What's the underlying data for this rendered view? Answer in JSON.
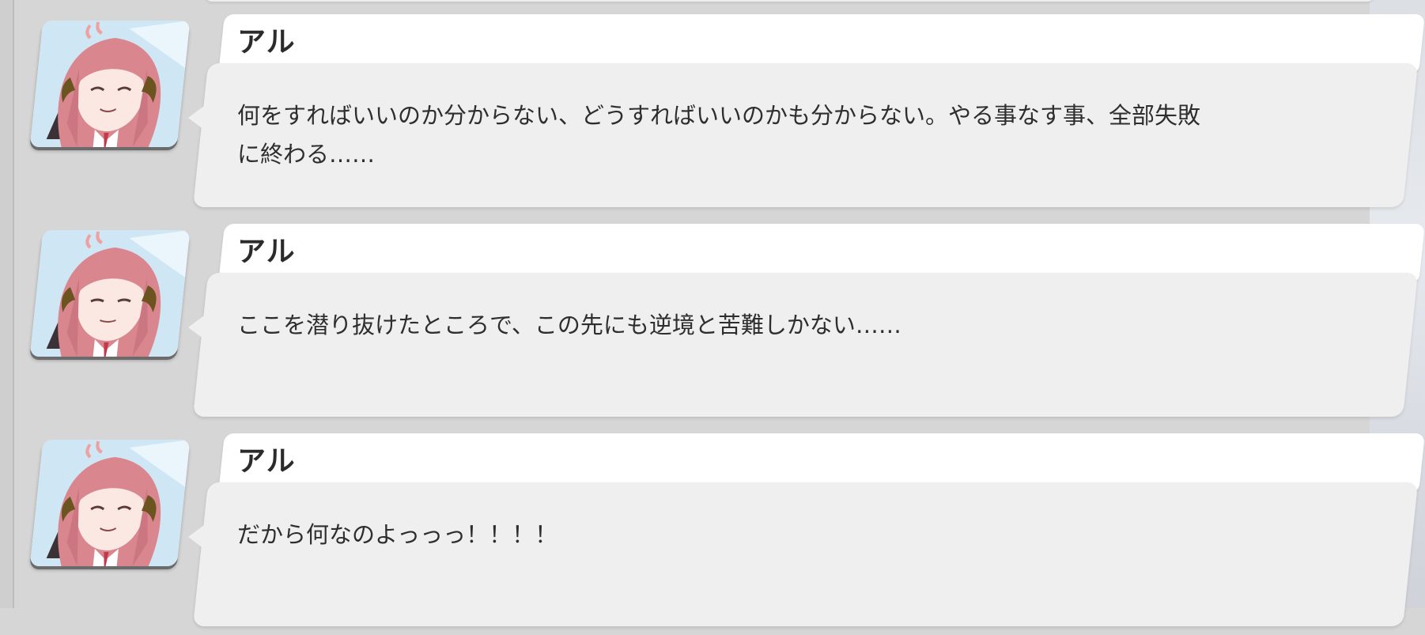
{
  "messages": [
    {
      "speaker": "アル",
      "text": "何をすればいいのか分からない、どうすればいいのかも分からない。やる事なす事、全部失敗\nに終わる……"
    },
    {
      "speaker": "アル",
      "text": "ここを潜り抜けたところで、この先にも逆境と苦難しかない……"
    },
    {
      "speaker": "アル",
      "text": "だから何なのよっっっ！！！！"
    }
  ],
  "colors": {
    "background": "#d6d6d6",
    "name_bar": "#ffffff",
    "bubble": "#efefef",
    "text": "#2e2e2e",
    "hair": "#d9868f"
  },
  "icons": {
    "avatar": "character-portrait-aru"
  }
}
